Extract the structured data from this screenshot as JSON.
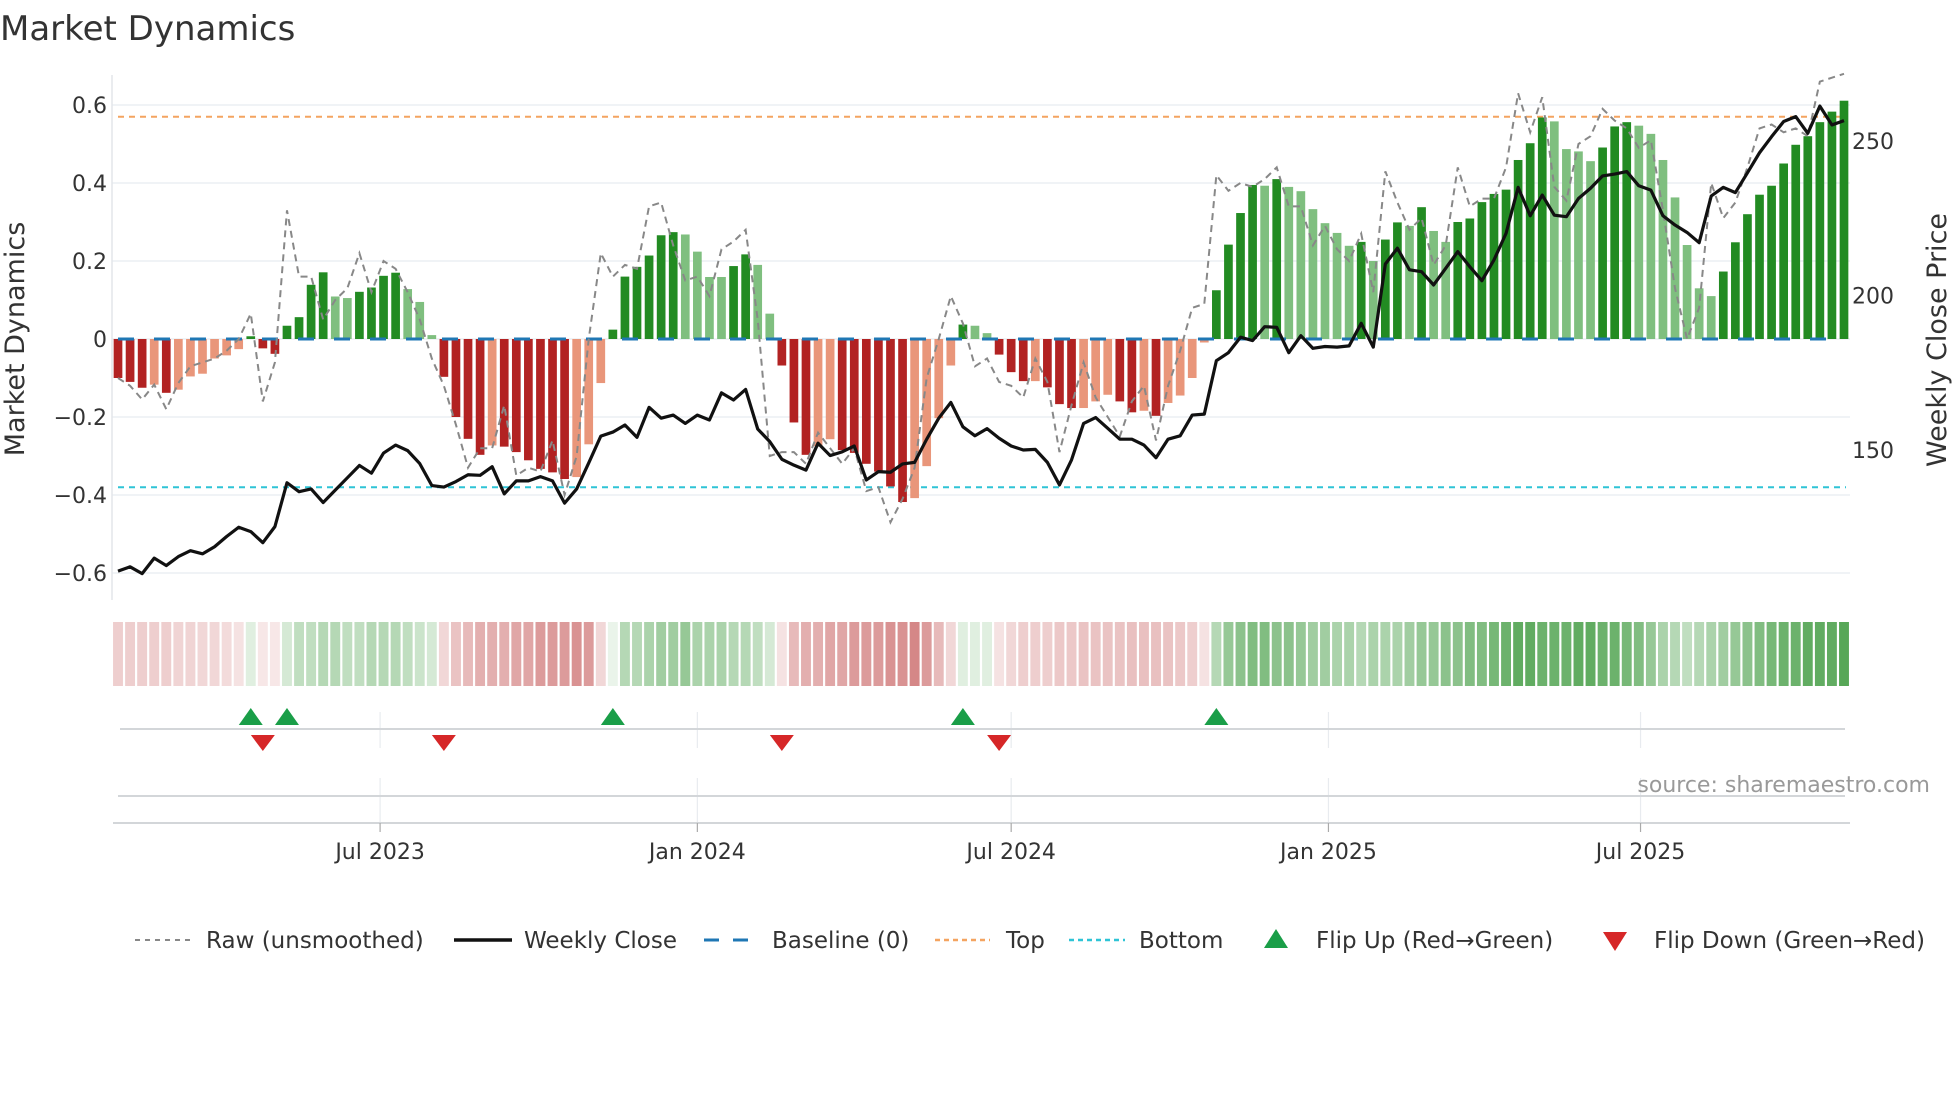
{
  "chart_data": {
    "type": "bar",
    "title": "Market Dynamics",
    "ylabel": "Market Dynamics",
    "y2label": "Weekly Close Price",
    "source": "source: sharemaestro.com",
    "start_week": "2023-01-30",
    "week_days": 7,
    "ylim": [
      -0.669,
      0.677
    ],
    "y_ticks": [
      0.6,
      0.4,
      0.2,
      0,
      -0.2,
      -0.4,
      -0.6
    ],
    "y_tick_labels": [
      "0.6",
      "0.4",
      "0.2",
      "0",
      "−0.2",
      "−0.4",
      "−0.6"
    ],
    "y2_ticks": [
      250,
      200,
      150
    ],
    "y2_tick_labels": [
      "250",
      "200",
      "150"
    ],
    "x_ticks": [
      {
        "date": "2023-07-01",
        "label": "Jul 2023"
      },
      {
        "date": "2024-01-01",
        "label": "Jan 2024"
      },
      {
        "date": "2024-07-01",
        "label": "Jul 2024"
      },
      {
        "date": "2025-01-01",
        "label": "Jan 2025"
      },
      {
        "date": "2025-07-01",
        "label": "Jul 2025"
      }
    ],
    "top_level": 0.57,
    "bottom_level": -0.38,
    "baseline": 0,
    "colors": {
      "pos_strong": "#228b22",
      "pos_weak": "#7fbf7f",
      "neg_strong": "#b22222",
      "neg_weak": "#e9967a",
      "raw": "#888888",
      "close": "#111111",
      "baseline": "#1f77b4",
      "top": "#f4a460",
      "bottom": "#2ec4d6",
      "flip_up": "#1a9e48",
      "flip_down": "#d62728",
      "strip_pos": "#228b22",
      "strip_neg": "#b22222"
    },
    "series": [
      {
        "name": "Market Dynamics (smoothed)",
        "values": [
          -0.1,
          -0.11,
          -0.125,
          -0.117,
          -0.138,
          -0.13,
          -0.096,
          -0.089,
          -0.05,
          -0.042,
          -0.026,
          0.007,
          -0.024,
          -0.038,
          0.034,
          0.056,
          0.139,
          0.171,
          0.109,
          0.105,
          0.121,
          0.132,
          0.162,
          0.17,
          0.128,
          0.095,
          0.01,
          -0.097,
          -0.2,
          -0.256,
          -0.297,
          -0.273,
          -0.276,
          -0.29,
          -0.311,
          -0.333,
          -0.342,
          -0.359,
          -0.354,
          -0.27,
          -0.113,
          0.024,
          0.16,
          0.185,
          0.214,
          0.266,
          0.274,
          0.268,
          0.224,
          0.159,
          0.159,
          0.187,
          0.217,
          0.19,
          0.065,
          -0.068,
          -0.214,
          -0.297,
          -0.275,
          -0.257,
          -0.285,
          -0.292,
          -0.32,
          -0.34,
          -0.378,
          -0.418,
          -0.408,
          -0.326,
          -0.203,
          -0.068,
          0.037,
          0.034,
          0.015,
          -0.04,
          -0.085,
          -0.108,
          -0.108,
          -0.124,
          -0.167,
          -0.177,
          -0.177,
          -0.16,
          -0.143,
          -0.16,
          -0.188,
          -0.184,
          -0.197,
          -0.164,
          -0.145,
          -0.1,
          -0.009,
          0.125,
          0.242,
          0.323,
          0.395,
          0.393,
          0.41,
          0.39,
          0.379,
          0.333,
          0.297,
          0.272,
          0.239,
          0.249,
          0.2,
          0.255,
          0.299,
          0.29,
          0.338,
          0.277,
          0.249,
          0.3,
          0.309,
          0.351,
          0.372,
          0.383,
          0.459,
          0.502,
          0.568,
          0.558,
          0.487,
          0.481,
          0.456,
          0.491,
          0.545,
          0.556,
          0.547,
          0.526,
          0.459,
          0.363,
          0.241,
          0.13,
          0.11,
          0.173,
          0.248,
          0.32,
          0.37,
          0.393,
          0.45,
          0.498,
          0.52,
          0.556,
          0.583,
          0.611
        ]
      },
      {
        "name": "Raw (unsmoothed)",
        "values": [
          -0.1,
          -0.12,
          -0.155,
          -0.117,
          -0.18,
          -0.113,
          -0.07,
          -0.06,
          -0.05,
          -0.03,
          0.0,
          0.065,
          -0.16,
          -0.06,
          0.33,
          0.16,
          0.16,
          0.05,
          0.1,
          0.13,
          0.22,
          0.12,
          0.2,
          0.18,
          0.12,
          0.05,
          -0.05,
          -0.12,
          -0.22,
          -0.33,
          -0.28,
          -0.28,
          -0.17,
          -0.35,
          -0.33,
          -0.34,
          -0.26,
          -0.4,
          -0.3,
          0.0,
          0.22,
          0.16,
          0.19,
          0.18,
          0.34,
          0.35,
          0.24,
          0.15,
          0.16,
          0.11,
          0.23,
          0.25,
          0.28,
          0.05,
          -0.3,
          -0.29,
          -0.29,
          -0.32,
          -0.24,
          -0.28,
          -0.32,
          -0.28,
          -0.39,
          -0.38,
          -0.47,
          -0.41,
          -0.33,
          -0.1,
          0.0,
          0.11,
          0.04,
          -0.07,
          -0.05,
          -0.11,
          -0.12,
          -0.15,
          -0.05,
          -0.11,
          -0.29,
          -0.17,
          -0.06,
          -0.15,
          -0.2,
          -0.25,
          -0.16,
          -0.12,
          -0.26,
          -0.12,
          -0.03,
          0.08,
          0.09,
          0.42,
          0.38,
          0.4,
          0.39,
          0.41,
          0.44,
          0.34,
          0.34,
          0.24,
          0.29,
          0.23,
          0.2,
          0.27,
          0.12,
          0.43,
          0.35,
          0.28,
          0.31,
          0.19,
          0.24,
          0.44,
          0.34,
          0.36,
          0.36,
          0.44,
          0.63,
          0.53,
          0.62,
          0.39,
          0.355,
          0.5,
          0.52,
          0.59,
          0.56,
          0.54,
          0.49,
          0.51,
          0.33,
          0.13,
          0.0,
          0.08,
          0.4,
          0.31,
          0.35,
          0.44,
          0.54,
          0.55,
          0.53,
          0.54,
          0.52,
          0.66,
          0.67,
          0.68
        ]
      },
      {
        "name": "Weekly Close",
        "axis": "right",
        "values": [
          110.8,
          112.2,
          110,
          115,
          112.6,
          115.5,
          117.4,
          116.4,
          118.7,
          122,
          125,
          123.6,
          120,
          125.2,
          139.4,
          136.5,
          137.4,
          133,
          137,
          141,
          145,
          142.5,
          149,
          151.6,
          149.8,
          145.6,
          138.5,
          138,
          139.8,
          142,
          141.8,
          144.6,
          135.8,
          140,
          140,
          141.4,
          140,
          132.8,
          137.4,
          145.8,
          154.5,
          155.8,
          158.1,
          154.1,
          163.8,
          160.3,
          161.3,
          158.6,
          161.3,
          159.7,
          168.5,
          166.2,
          169.6,
          156.8,
          152.7,
          147,
          145.1,
          143.5,
          152.2,
          148.2,
          149.4,
          151.3,
          140.3,
          143,
          142.8,
          145.5,
          146,
          153.5,
          160.3,
          165.4,
          157.5,
          154.6,
          156.9,
          153.8,
          151.3,
          150,
          150.2,
          146,
          138.7,
          146.8,
          158.6,
          160.5,
          157,
          153.5,
          153.5,
          151.6,
          147.5,
          153.5,
          154.6,
          161.3,
          161.6,
          178.9,
          181.5,
          186.5,
          185.4,
          189.9,
          189.7,
          181.5,
          187,
          182.9,
          183.5,
          183.3,
          183.7,
          191,
          183.3,
          210.2,
          215.3,
          208.3,
          207.7,
          203.4,
          208.8,
          214.2,
          209.3,
          204.8,
          211.5,
          220.1,
          235,
          225.8,
          232.5,
          226,
          225.5,
          231.4,
          234.7,
          238.7,
          239.3,
          240.1,
          235.5,
          234.1,
          225.8,
          222.8,
          220.4,
          217.1,
          232.2,
          235,
          233.3,
          239.7,
          246.2,
          251.4,
          256.3,
          257.9,
          252.5,
          261.3,
          255.2,
          256.6
        ]
      },
      {
        "name": "Regime strip",
        "values": [
          -0.25,
          -0.25,
          -0.25,
          -0.25,
          -0.25,
          -0.22,
          -0.22,
          -0.2,
          -0.2,
          -0.18,
          -0.15,
          0.15,
          -0.12,
          -0.12,
          0.2,
          0.3,
          0.3,
          0.35,
          0.35,
          0.3,
          0.3,
          0.35,
          0.35,
          0.35,
          0.3,
          0.25,
          0.2,
          -0.2,
          -0.3,
          -0.35,
          -0.4,
          -0.4,
          -0.4,
          -0.45,
          -0.45,
          -0.5,
          -0.5,
          -0.5,
          -0.55,
          -0.5,
          -0.2,
          0.1,
          0.35,
          0.35,
          0.4,
          0.45,
          0.45,
          0.5,
          0.4,
          0.4,
          0.4,
          0.35,
          0.35,
          0.3,
          0.2,
          -0.15,
          -0.35,
          -0.4,
          -0.4,
          -0.45,
          -0.45,
          -0.5,
          -0.5,
          -0.5,
          -0.55,
          -0.55,
          -0.6,
          -0.5,
          -0.35,
          -0.2,
          0.15,
          0.15,
          0.15,
          -0.15,
          -0.2,
          -0.25,
          -0.25,
          -0.25,
          -0.28,
          -0.28,
          -0.3,
          -0.3,
          -0.3,
          -0.3,
          -0.32,
          -0.32,
          -0.32,
          -0.3,
          -0.28,
          -0.25,
          -0.15,
          0.35,
          0.5,
          0.55,
          0.6,
          0.6,
          0.55,
          0.55,
          0.5,
          0.45,
          0.45,
          0.4,
          0.4,
          0.35,
          0.4,
          0.4,
          0.4,
          0.45,
          0.5,
          0.5,
          0.55,
          0.55,
          0.6,
          0.6,
          0.65,
          0.7,
          0.75,
          0.75,
          0.7,
          0.7,
          0.7,
          0.75,
          0.75,
          0.7,
          0.7,
          0.65,
          0.6,
          0.5,
          0.4,
          0.35,
          0.3,
          0.35,
          0.4,
          0.45,
          0.5,
          0.55,
          0.6,
          0.65,
          0.7,
          0.7,
          0.75,
          0.75,
          0.75,
          0.8
        ]
      }
    ],
    "flip_up_weeks": [
      11,
      14,
      41,
      70,
      91
    ],
    "flip_down_weeks": [
      12,
      27,
      55,
      73
    ],
    "legend": {
      "position": "bottom",
      "items": [
        {
          "label": "Raw (unsmoothed)",
          "kind": "raw"
        },
        {
          "label": "Weekly Close",
          "kind": "close"
        },
        {
          "label": "Baseline (0)",
          "kind": "baseline"
        },
        {
          "label": "Top",
          "kind": "top"
        },
        {
          "label": "Bottom",
          "kind": "bottom"
        },
        {
          "label": "Flip Up (Red→Green)",
          "kind": "flip_up"
        },
        {
          "label": "Flip Down (Green→Red)",
          "kind": "flip_down"
        }
      ]
    },
    "grid": true
  }
}
